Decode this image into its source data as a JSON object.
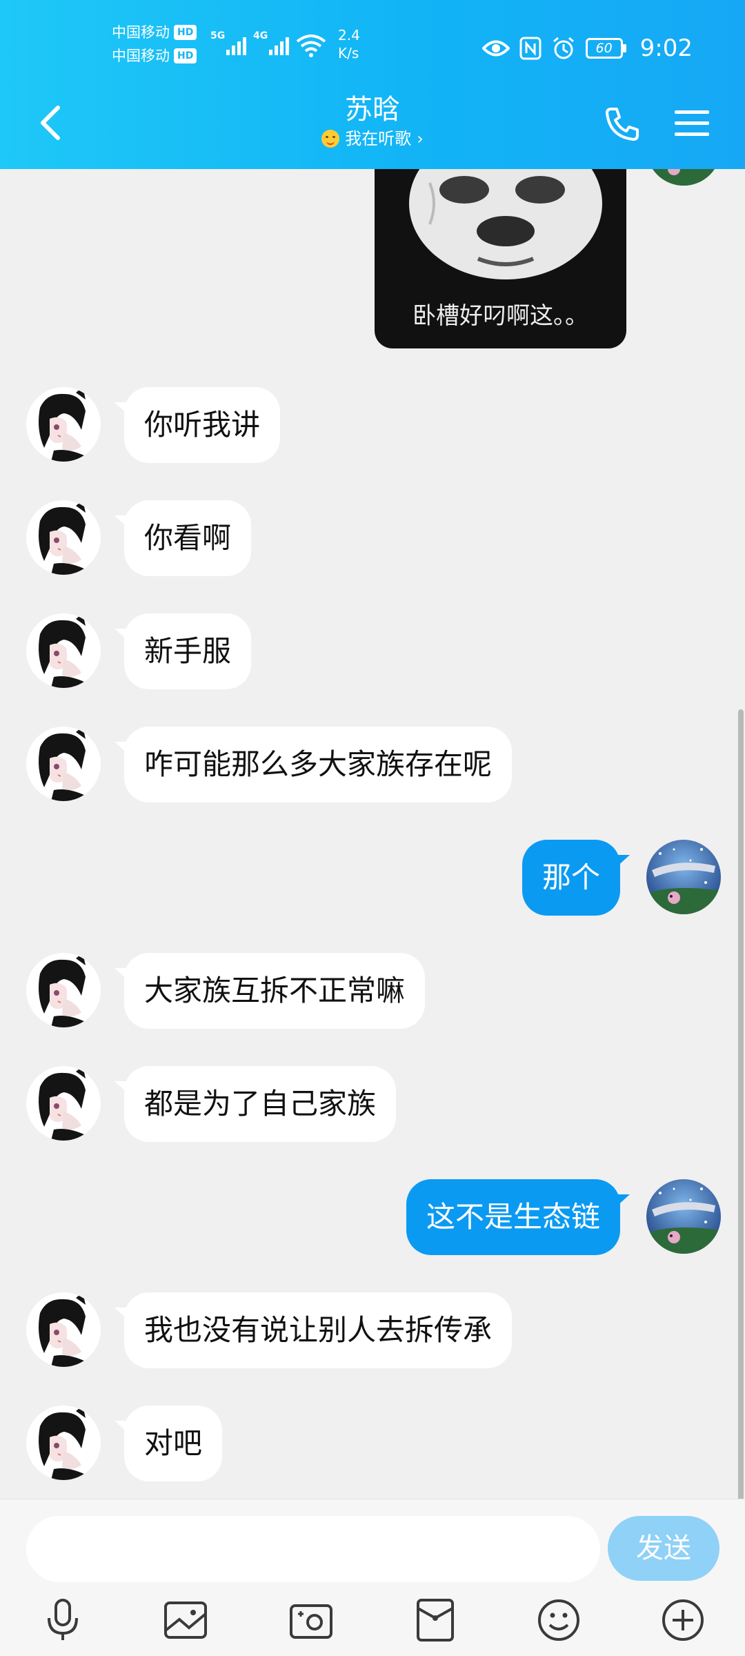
{
  "status_bar": {
    "carrier1": "中国移动",
    "carrier2": "中国移动",
    "hd_badge": "HD",
    "sim1_gen": "5G",
    "sim2_gen": "4G",
    "speed_value": "2.4",
    "speed_unit": "K/s",
    "battery": "60",
    "time": "9:02"
  },
  "header": {
    "title": "苏晗",
    "status_text": "我在听歌",
    "status_chevron": "›"
  },
  "sticker": {
    "caption": "卧槽好叼啊这。。"
  },
  "messages": [
    {
      "side": "left",
      "text": "你听我讲"
    },
    {
      "side": "left",
      "text": "你看啊"
    },
    {
      "side": "left",
      "text": "新手服"
    },
    {
      "side": "left",
      "text": "咋可能那么多大家族存在呢"
    },
    {
      "side": "right",
      "text": "那个"
    },
    {
      "side": "left",
      "text": "大家族互拆不正常嘛"
    },
    {
      "side": "left",
      "text": "都是为了自己家族"
    },
    {
      "side": "right",
      "text": "这不是生态链"
    },
    {
      "side": "left",
      "text": "我也没有说让别人去拆传承"
    },
    {
      "side": "left",
      "text": "对吧"
    }
  ],
  "input": {
    "placeholder": "",
    "value": "",
    "send_label": "发送"
  },
  "toolbar_icons": [
    "microphone-icon",
    "image-icon",
    "camera-icon",
    "red-packet-icon",
    "emoji-icon",
    "plus-icon"
  ],
  "colors": {
    "header_start": "#1ec8f7",
    "header_end": "#16a8f5",
    "own_bubble": "#0b9af2",
    "send_button": "#8fd1f7",
    "background": "#f0f0f0"
  }
}
